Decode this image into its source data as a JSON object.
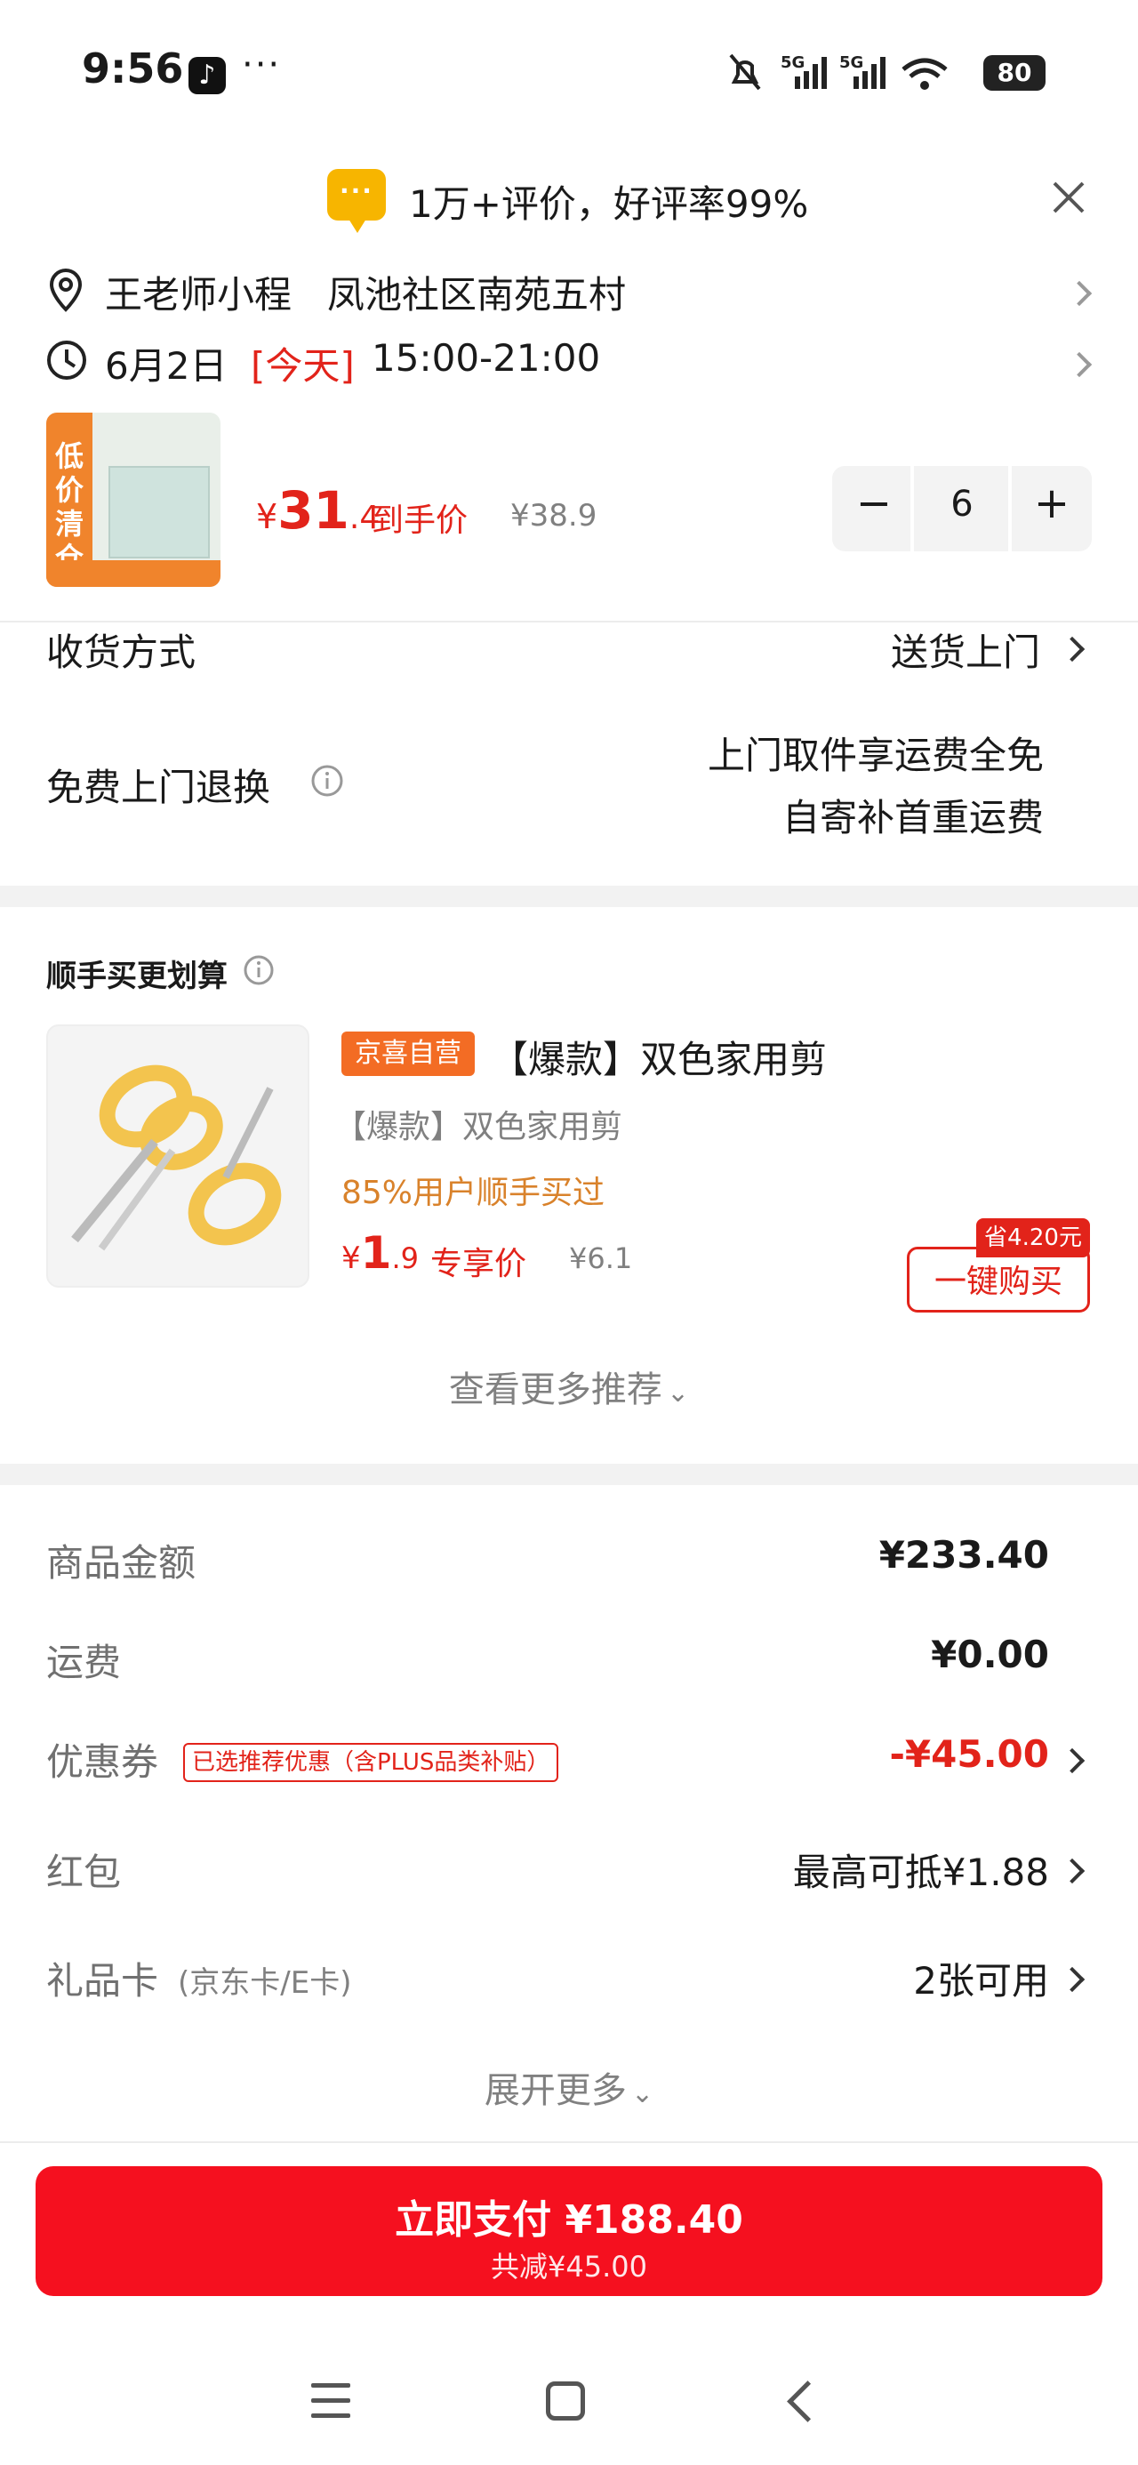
{
  "status": {
    "time": "9:56",
    "battery": "80",
    "network": "5G",
    "app_icon": "tiktok-icon",
    "more": "···"
  },
  "banner": {
    "icon": "chat-bubble-icon",
    "icon_glyph": "···",
    "text": "1万+评价，好评率99%",
    "close_icon": "close-icon"
  },
  "address": {
    "name": "王老师小程",
    "location": "凤池社区南苑五村"
  },
  "delivery_time": {
    "date": "6月2日",
    "tag": "[今天]",
    "window": "15:00-21:00"
  },
  "product": {
    "thumb_badge": "低价清仓",
    "price_symbol": "¥",
    "price_int": "31",
    "price_dec": ".4",
    "price_label": "到手价",
    "original_price": "¥38.9",
    "qty": "6",
    "minus": "−",
    "plus": "+"
  },
  "shipping": {
    "label": "收货方式",
    "value": "送货上门"
  },
  "returns": {
    "label": "免费上门退换",
    "line1": "上门取件享运费全免",
    "line2": "自寄补首重运费"
  },
  "addon": {
    "section_title": "顺手买更划算",
    "tag": "京喜自营",
    "name": "【爆款】双色家用剪",
    "subtitle": "【爆款】双色家用剪",
    "social": "85%用户顺手买过",
    "price_symbol": "¥",
    "price_int": "1",
    "price_dec": ".9",
    "price_label": "专享价",
    "original_price": "¥6.1",
    "save_badge": "省4.20元",
    "buy_button": "一键购买",
    "more": "查看更多推荐"
  },
  "summary": {
    "goods": {
      "label": "商品金额",
      "value": "¥233.40"
    },
    "freight": {
      "label": "运费",
      "value": "¥0.00"
    },
    "coupon": {
      "label": "优惠券",
      "tag": "已选推荐优惠（含PLUS品类补贴）",
      "value": "-¥45.00"
    },
    "redpacket": {
      "label": "红包",
      "value": "最高可抵¥1.88"
    },
    "giftcard": {
      "label": "礼品卡",
      "sub": "(京东卡/E卡)",
      "value": "2张可用"
    },
    "expand": "展开更多"
  },
  "pay": {
    "label": "立即支付 ¥188.40",
    "sub": "共减¥45.00"
  },
  "colors": {
    "accent": "#e2231a",
    "pay_button": "#f5101f",
    "tag_orange": "#f36c24",
    "banner_icon": "#f7b500"
  }
}
